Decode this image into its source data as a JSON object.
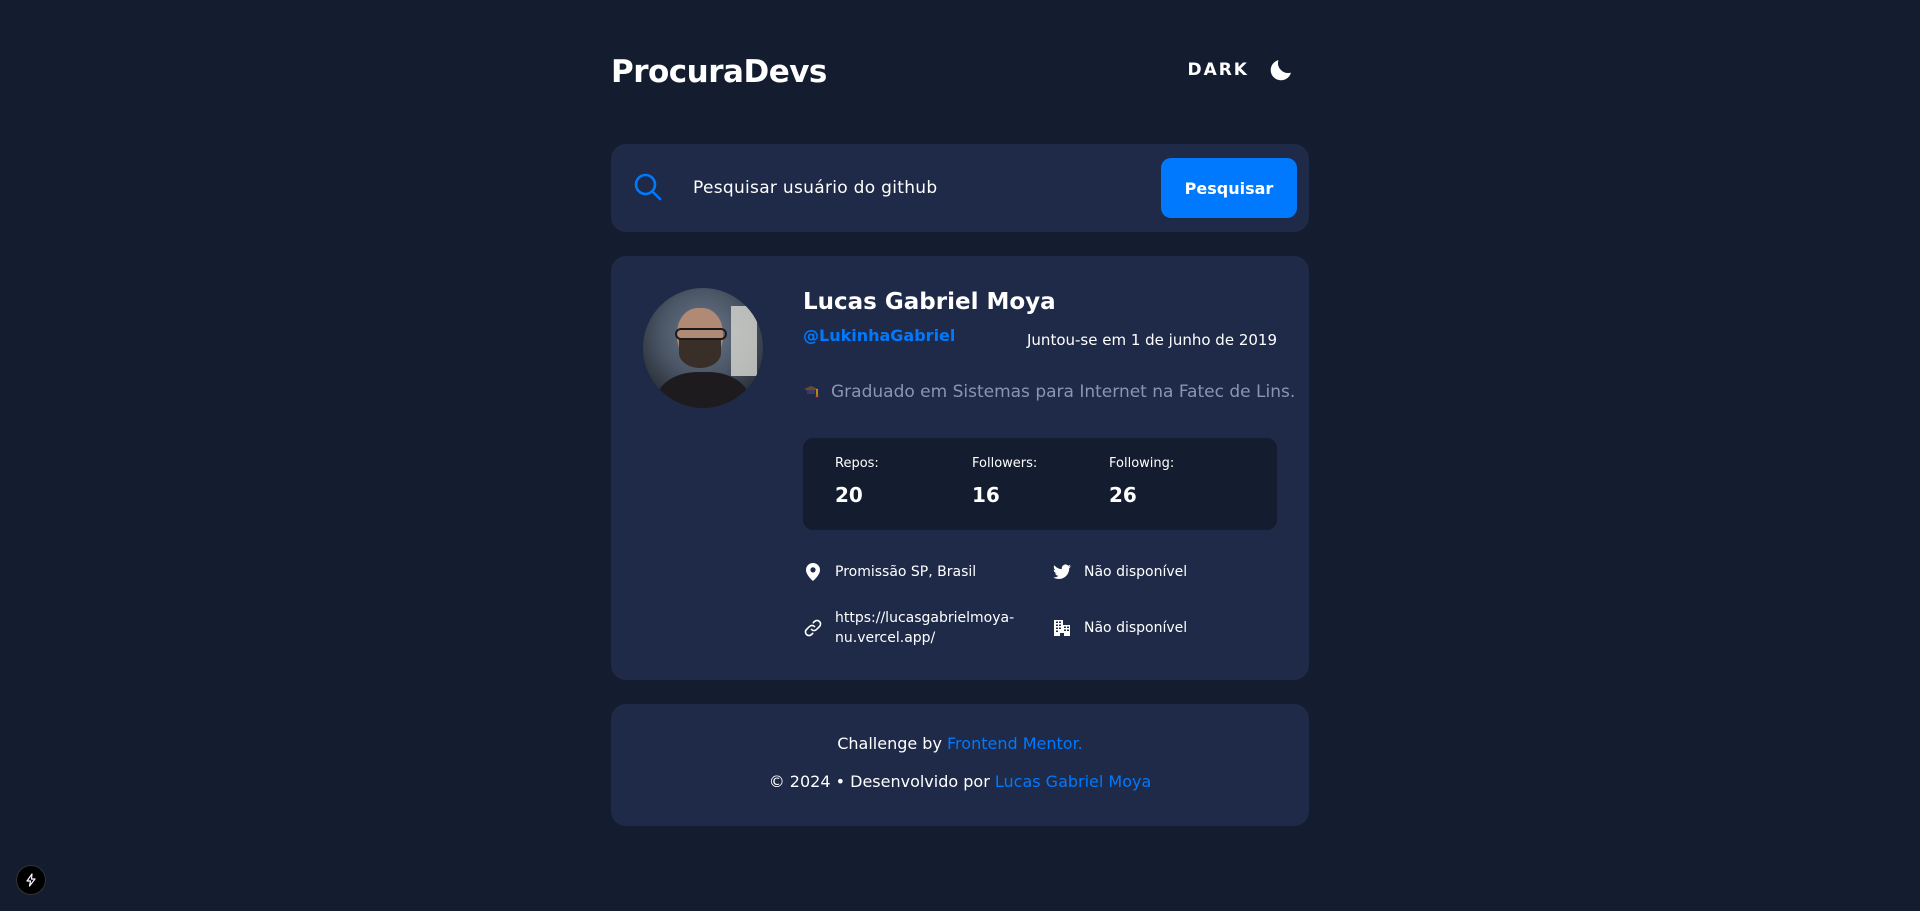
{
  "header": {
    "logo": "ProcuraDevs",
    "theme_label": "DARK",
    "theme_icon": "moon-icon"
  },
  "search": {
    "placeholder": "Pesquisar usuário do github",
    "button_label": "Pesquisar"
  },
  "profile": {
    "name": "Lucas Gabriel Moya",
    "login": "@LukinhaGabriel",
    "joined": "Juntou-se em 1 de junho de 2019",
    "bio": "Graduado em Sistemas para Internet na Fatec de Lins.",
    "stats": [
      {
        "label": "Repos:",
        "value": "20"
      },
      {
        "label": "Followers:",
        "value": "16"
      },
      {
        "label": "Following:",
        "value": "26"
      }
    ],
    "location": "Promissão SP, Brasil",
    "twitter": "Não disponível",
    "blog": "https://lucasgabrielmoya-nu.vercel.app/",
    "company": "Não disponível"
  },
  "footer": {
    "challenge_prefix": "Challenge by",
    "challenge_link": "Frontend Mentor.",
    "copyright_prefix": "© 2024 • Desenvolvido por",
    "author_link": "Lucas Gabriel Moya"
  },
  "colors": {
    "background": "#141d2f",
    "card": "#1e2a47",
    "accent": "#0079ff",
    "muted": "#8a96b0"
  }
}
